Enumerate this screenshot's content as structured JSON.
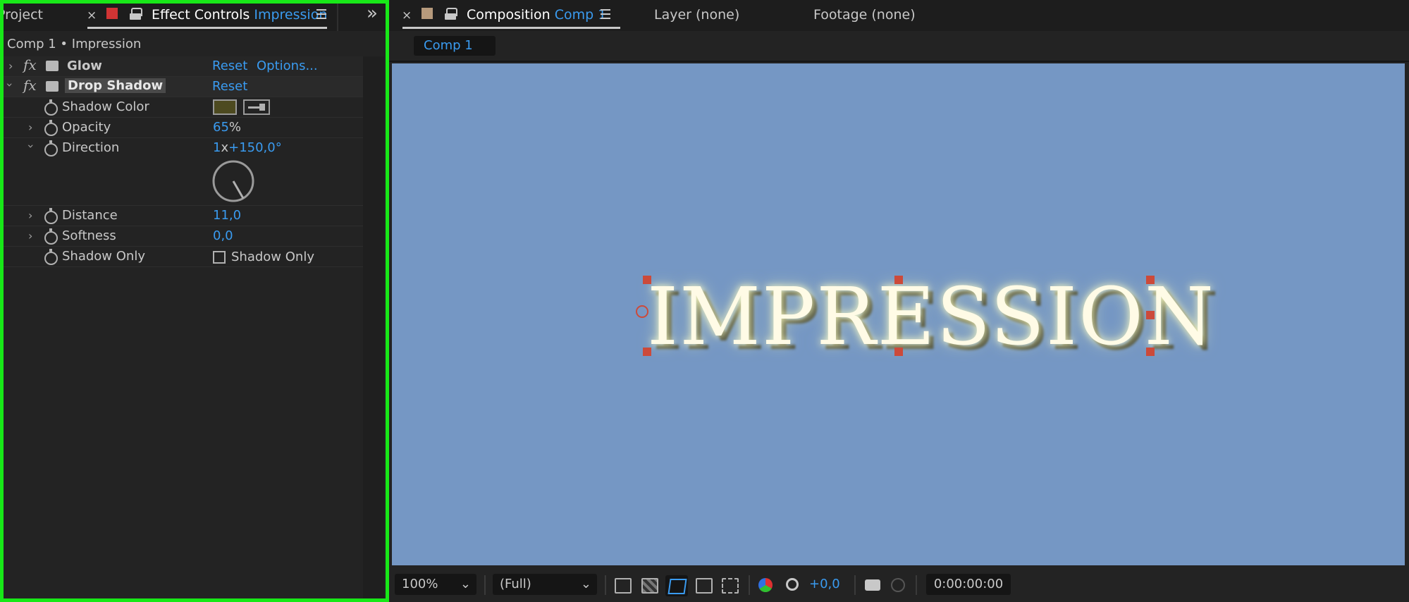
{
  "left_tabs": {
    "project": "Project",
    "close": "×",
    "effect_controls": "Effect Controls",
    "layer_name": "Impression",
    "overflow": "»"
  },
  "breadcrumb": "Comp 1 • Impression",
  "effects": [
    {
      "name": "Glow",
      "reset": "Reset",
      "options": "Options..."
    },
    {
      "name": "Drop Shadow",
      "reset": "Reset"
    }
  ],
  "properties": {
    "shadow_color": {
      "label": "Shadow Color",
      "color": "#4d4a20"
    },
    "opacity": {
      "label": "Opacity",
      "value": "65",
      "unit": "%"
    },
    "direction": {
      "label": "Direction",
      "revs": "1",
      "x": "x",
      "angle": "+150,0°",
      "angle_deg": 150
    },
    "distance": {
      "label": "Distance",
      "value": "11,0"
    },
    "softness": {
      "label": "Softness",
      "value": "0,0"
    },
    "shadow_only": {
      "label": "Shadow Only",
      "checkbox_label": "Shadow Only",
      "checked": false
    }
  },
  "right_tabs": {
    "close": "×",
    "composition": "Composition",
    "comp_name": "Comp 1",
    "layer": "Layer (none)",
    "footage": "Footage (none)"
  },
  "comp_subtab": "Comp 1",
  "viewer": {
    "text": "IMPRESSION",
    "background": "#7597c4"
  },
  "bottom_bar": {
    "zoom": "100%",
    "resolution": "(Full)",
    "exposure": "+0,0",
    "timecode": "0:00:00:00"
  },
  "colors": {
    "accent": "#3a9bf0",
    "selection_border": "#18e818",
    "handle": "#cc4a3a"
  }
}
